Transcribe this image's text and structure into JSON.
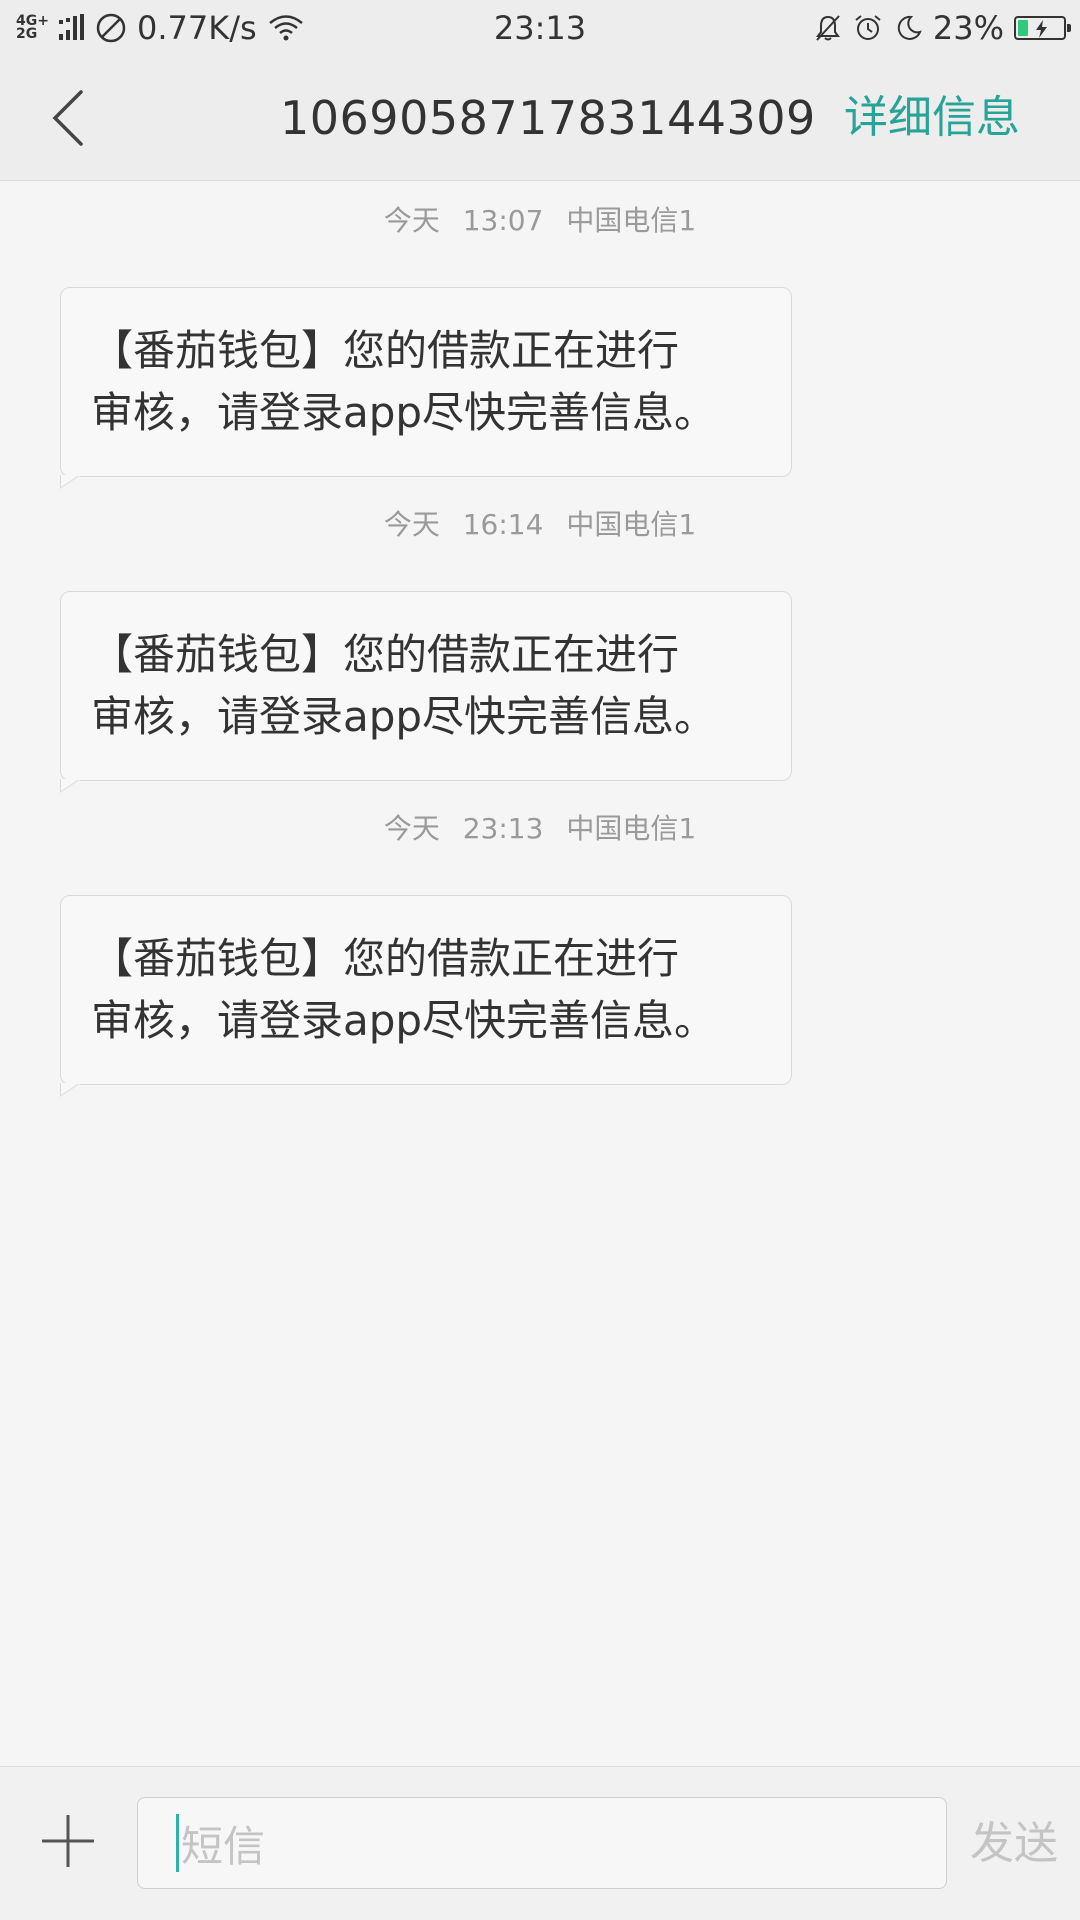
{
  "status_bar": {
    "network_top": "4G+",
    "network_bottom": "2G",
    "speed": "0.77K/s",
    "time": "23:13",
    "battery": "23%",
    "battery_level": 0.23,
    "battery_color": "#2ec97a"
  },
  "header": {
    "title": "106905871783144309",
    "details_label": "详细信息",
    "accent_color": "#27a397"
  },
  "messages": [
    {
      "day": "今天",
      "time": "13:07",
      "carrier": "中国电信1",
      "line1": "【番茄钱包】您的借款正在进行",
      "line2": "审核，请登录app尽快完善信息。"
    },
    {
      "day": "今天",
      "time": "16:14",
      "carrier": "中国电信1",
      "line1": "【番茄钱包】您的借款正在进行",
      "line2": "审核，请登录app尽快完善信息。"
    },
    {
      "day": "今天",
      "time": "23:13",
      "carrier": "中国电信1",
      "line1": "【番茄钱包】您的借款正在进行",
      "line2": "审核，请登录app尽快完善信息。"
    }
  ],
  "composer": {
    "placeholder": "短信",
    "send_label": "发送"
  },
  "icons": {
    "back": "chevron-left-icon",
    "add": "plus-icon",
    "no_sim": "no-sim-icon",
    "wifi": "wifi-icon",
    "mute": "bell-off-icon",
    "alarm": "alarm-icon",
    "dnd": "moon-icon",
    "battery": "battery-icon"
  }
}
